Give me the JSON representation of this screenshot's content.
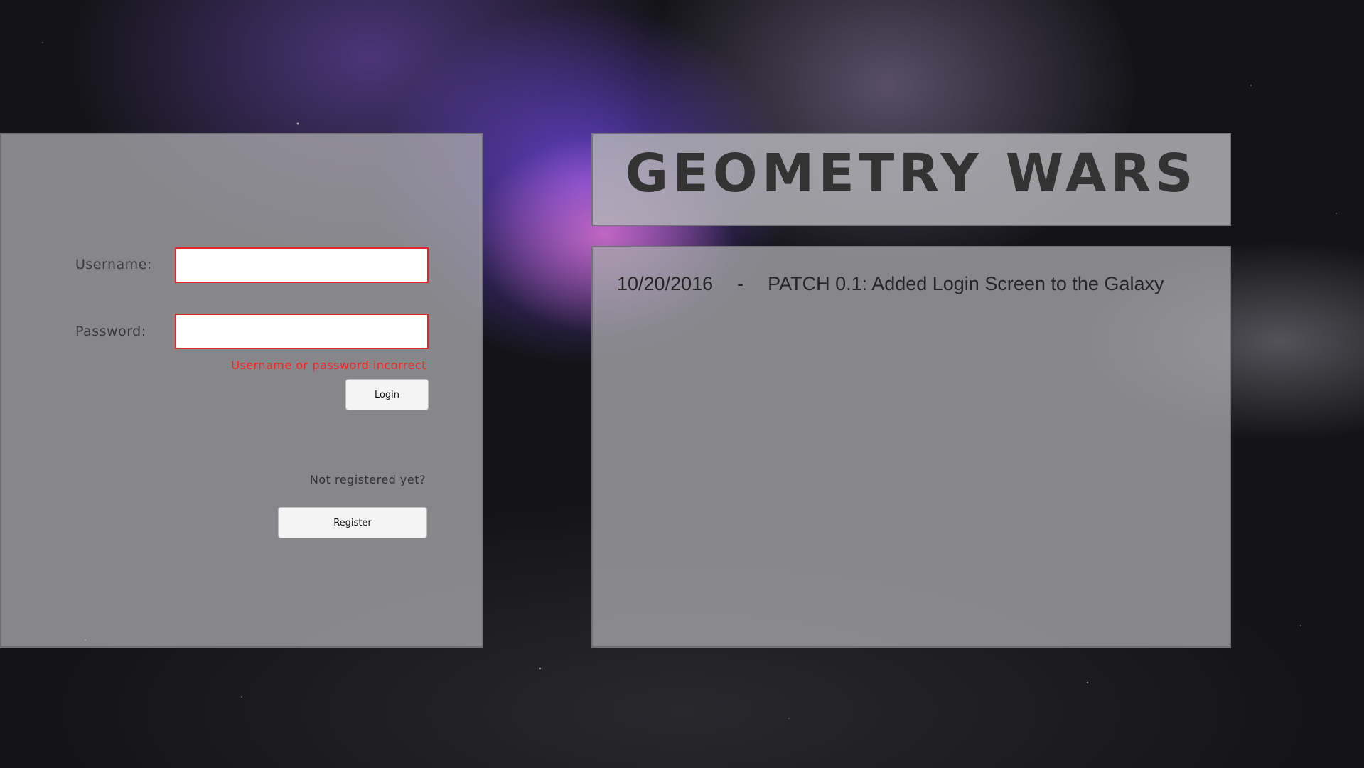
{
  "login": {
    "username_label": "Username:",
    "username_value": "",
    "password_label": "Password:",
    "password_value": "",
    "error_message": "Username or password incorrect",
    "login_button": "Login",
    "not_registered_text": "Not registered yet?",
    "register_button": "Register"
  },
  "header": {
    "title": "GEOMETRY WARS"
  },
  "news": {
    "items": [
      {
        "date": "10/20/2016",
        "separator": "-",
        "text": "PATCH 0.1: Added Login Screen to the Galaxy"
      }
    ]
  },
  "colors": {
    "error": "#ff1f1f",
    "input_border": "#e0262b",
    "panel": "#a8a8ac",
    "title_text": "#333333"
  }
}
